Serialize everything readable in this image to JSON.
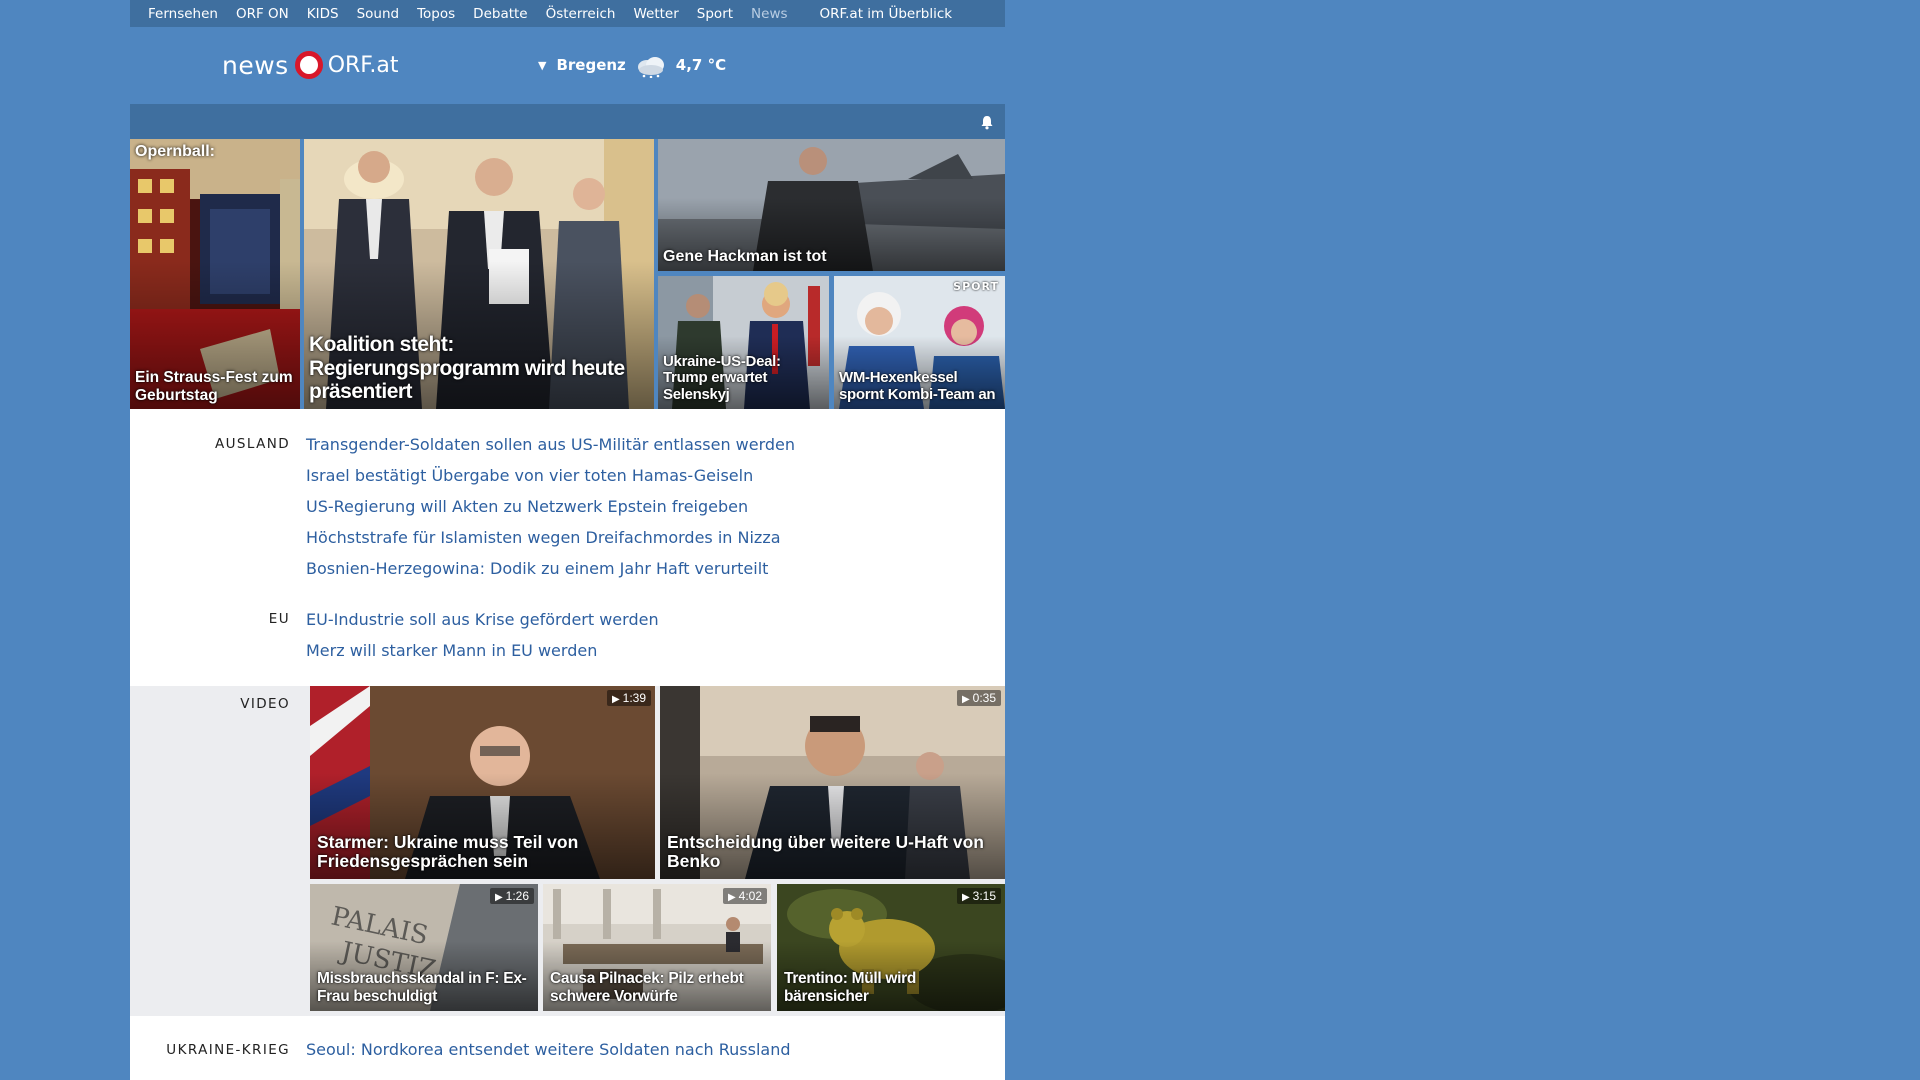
{
  "nav": {
    "items": [
      "Fernsehen",
      "ORF ON",
      "KIDS",
      "Sound",
      "Topos",
      "Debatte",
      "Österreich",
      "Wetter",
      "Sport",
      "News"
    ],
    "overview": "ORF.at im Überblick"
  },
  "header": {
    "logo_news": "news",
    "logo_orf": "ORF.at",
    "weather": {
      "city": "Bregenz",
      "temp": "4,7 °C",
      "icon": "cloudy-snow-icon"
    }
  },
  "hero": {
    "opernball_tag": "Opernball:",
    "opernball_caption": "Ein Strauss-Fest zum Geburtstag",
    "main_caption": "Koalition steht: Regierungsprogramm wird heute präsentiert",
    "hackman_caption": "Gene Hackman ist tot",
    "ukraine_caption": "Ukraine-US-Deal: Trump erwartet Selenskyj",
    "sport_tag": "SPORT",
    "sport_caption": "WM-Hexenkessel spornt Kombi-Team an"
  },
  "sections": {
    "ausland": {
      "label": "AUSLAND",
      "links": [
        "Transgender-Soldaten sollen aus US-Militär entlassen werden",
        "Israel bestätigt Übergabe von vier toten Hamas-Geiseln",
        "US-Regierung will Akten zu Netzwerk Epstein freigeben",
        "Höchststrafe für Islamisten wegen Dreifachmordes in Nizza",
        "Bosnien-Herzegowina: Dodik zu einem Jahr Haft verurteilt"
      ]
    },
    "eu": {
      "label": "EU",
      "links": [
        "EU-Industrie soll aus Krise gefördert werden",
        "Merz will starker Mann in EU werden"
      ]
    },
    "video": {
      "label": "VIDEO",
      "items": [
        {
          "title": "Starmer: Ukraine muss Teil von Friedensgesprächen sein",
          "duration": "1:39"
        },
        {
          "title": "Entscheidung über weitere U-Haft von Benko",
          "duration": "0:35"
        },
        {
          "title": "Missbrauchsskandal in F: Ex-Frau beschuldigt",
          "duration": "1:26"
        },
        {
          "title": "Causa Pilnacek: Pilz erhebt schwere Vorwürfe",
          "duration": "4:02"
        },
        {
          "title": "Trentino: Müll wird bärensicher",
          "duration": "3:15"
        }
      ]
    },
    "ukraine": {
      "label": "UKRAINE-KRIEG",
      "links": [
        "Seoul: Nordkorea entsendet weitere Soldaten nach Russland"
      ]
    }
  }
}
